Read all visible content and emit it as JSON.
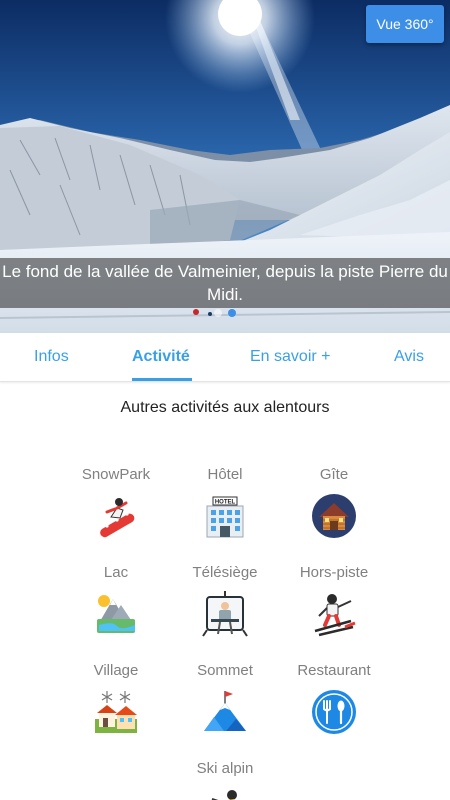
{
  "hero": {
    "button_360": "Vue 360°",
    "caption": "Le fond de la vallée de Valmeinier, depuis la piste Pierre du Midi.",
    "carousel": {
      "count": 2,
      "active_index": 1
    }
  },
  "tabs": [
    {
      "label": "Infos",
      "active": false
    },
    {
      "label": "Activité",
      "active": true
    },
    {
      "label": "En savoir +",
      "active": false
    },
    {
      "label": "Avis",
      "active": false
    }
  ],
  "section": {
    "title": "Autres activités aux alentours"
  },
  "activities": [
    {
      "label": "SnowPark",
      "icon": "snowboarder-icon"
    },
    {
      "label": "Hôtel",
      "icon": "hotel-icon",
      "icon_text": "HOTEL"
    },
    {
      "label": "Gîte",
      "icon": "chalet-icon"
    },
    {
      "label": "Lac",
      "icon": "lake-icon"
    },
    {
      "label": "Télésiège",
      "icon": "chairlift-icon"
    },
    {
      "label": "Hors-piste",
      "icon": "offpiste-skier-icon"
    },
    {
      "label": "Village",
      "icon": "village-icon"
    },
    {
      "label": "Sommet",
      "icon": "summit-icon"
    },
    {
      "label": "Restaurant",
      "icon": "restaurant-icon"
    },
    {
      "label": "Ski alpin",
      "icon": "alpine-skier-icon"
    }
  ],
  "colors": {
    "accent": "#3aa0e6",
    "button": "#3d8ee6",
    "label_gray": "#808080"
  }
}
